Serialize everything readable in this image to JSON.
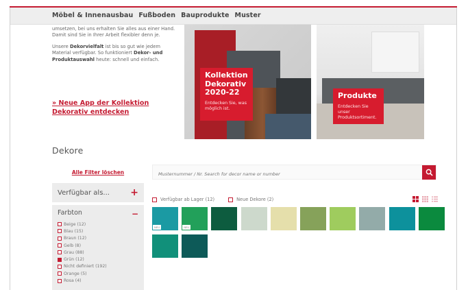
{
  "nav": {
    "items": [
      "Möbel & Innenausbau",
      "Fußboden",
      "Bauprodukte",
      "Muster"
    ]
  },
  "intro": {
    "p1": "umsetzen, bei uns erhalten Sie alles aus einer Hand. Damit sind Sie in Ihrer Arbeit flexibler denn je.",
    "p2_pre": "Unsere ",
    "p2_bold1": "Dekorvielfalt",
    "p2_mid": " ist bis so gut wie jedem Material verfügbar. So funktioniert ",
    "p2_bold2": "Dekor- und Produktauswahl",
    "p2_post": " heute: schnell und einfach.",
    "link": "» Neue App der Kollektion Dekorativ entdecken"
  },
  "promo1": {
    "title": "Kollektion Dekorativ 2020-22",
    "subtitle": "Entdecken Sie, was möglich ist."
  },
  "promo2": {
    "title": "Produkte",
    "subtitle": "Entdecken Sie unser Produktsortiment."
  },
  "page_title": "Dekore",
  "sidebar": {
    "reset": "Alle Filter löschen",
    "available_label": "Verfügbar als...",
    "colour_label": "Farbton",
    "options": [
      {
        "label": "Beige (12)",
        "checked": false
      },
      {
        "label": "Blau (15)",
        "checked": false
      },
      {
        "label": "Braun (12)",
        "checked": false
      },
      {
        "label": "Gelb (8)",
        "checked": false
      },
      {
        "label": "Grau (88)",
        "checked": false
      },
      {
        "label": "Grün (12)",
        "checked": true
      },
      {
        "label": "Nicht definiert (192)",
        "checked": false
      },
      {
        "label": "Orange (5)",
        "checked": false
      },
      {
        "label": "Rosa (4)",
        "checked": false
      }
    ]
  },
  "search": {
    "placeholder": "Musternummer / Nr. Search for decor name or number"
  },
  "filters": {
    "stock": "Verfügbar ab Lager (12)",
    "new": "Neue Dekore (2)"
  },
  "swatches": [
    {
      "color": "#1b9aa3",
      "badge": "NEU"
    },
    {
      "color": "#22a05a",
      "badge": "NEU"
    },
    {
      "color": "#0d5c3f",
      "badge": ""
    },
    {
      "color": "#cdd9cc",
      "badge": ""
    },
    {
      "color": "#e5dfab",
      "badge": ""
    },
    {
      "color": "#86a25a",
      "badge": ""
    },
    {
      "color": "#9fcc5e",
      "badge": ""
    },
    {
      "color": "#93aba9",
      "badge": ""
    },
    {
      "color": "#0d919c",
      "badge": ""
    },
    {
      "color": "#0b8a3e",
      "badge": ""
    },
    {
      "color": "#11907a",
      "badge": ""
    },
    {
      "color": "#0d5a58",
      "badge": ""
    }
  ],
  "colors": {
    "brand_red": "#c41a31",
    "promo_red": "#d71c2e"
  }
}
